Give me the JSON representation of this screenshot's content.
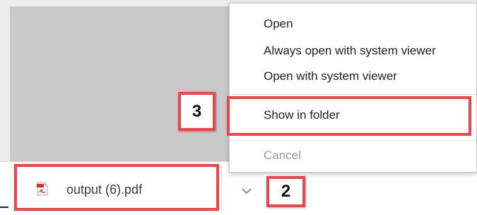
{
  "context_menu": {
    "items": [
      {
        "label": "Open",
        "enabled": true
      },
      {
        "label": "Always open with system viewer",
        "enabled": true
      },
      {
        "label": "Open with system viewer",
        "enabled": true
      },
      {
        "label": "Show in folder",
        "enabled": true,
        "highlighted": true
      },
      {
        "label": "Cancel",
        "enabled": false
      }
    ]
  },
  "download_shelf": {
    "file_name": "output (6).pdf",
    "file_icon": "pdf-file-icon",
    "menu_icon": "chevron-down-icon"
  },
  "callouts": {
    "step_2": "2",
    "step_3": "3"
  },
  "colors": {
    "highlight_border": "#e8474e",
    "page_background": "#c9c9c9",
    "disabled_text": "#9a9a9a"
  }
}
